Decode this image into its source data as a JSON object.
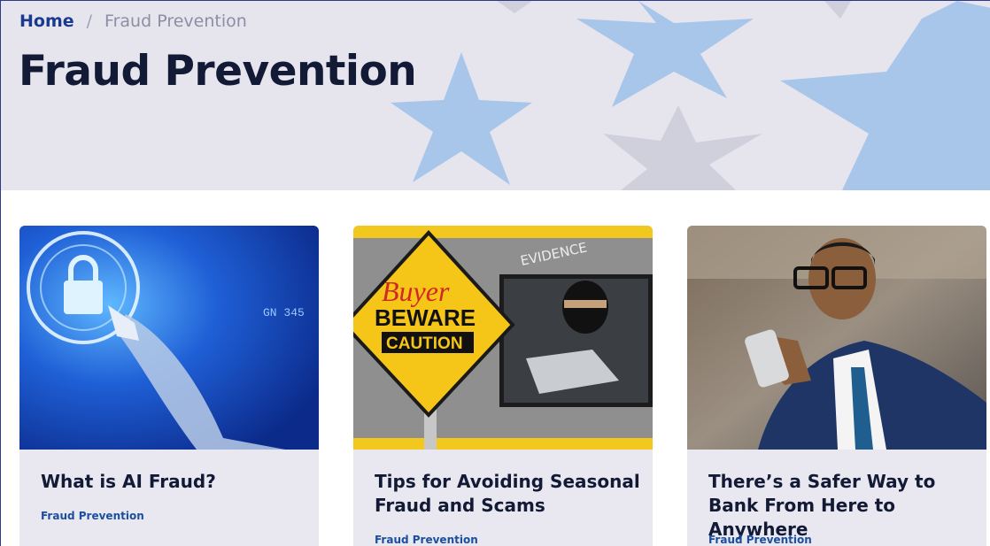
{
  "breadcrumb": {
    "home": "Home",
    "separator": "/",
    "current": "Fraud Prevention"
  },
  "page": {
    "title": "Fraud Prevention"
  },
  "cards": [
    {
      "title": "What is AI Fraud?",
      "category": "Fraud Prevention",
      "image_text": [
        "GN 345"
      ]
    },
    {
      "title": "Tips for Avoiding Seasonal Fraud and Scams",
      "category": "Fraud Prevention",
      "image_text": [
        "Buyer",
        "BEWARE",
        "CAUTION",
        "EVIDENCE"
      ]
    },
    {
      "title": "There’s a Safer Way to Bank From Here to Anywhere",
      "category": "Fraud Prevention",
      "image_text": []
    }
  ],
  "colors": {
    "brand_navy": "#131a36",
    "link_blue": "#1a3a8f",
    "category_blue": "#1a4fa0",
    "hero_bg": "#e6e5ee",
    "card_bg": "#e9e8f1",
    "star_blue": "#a8c6ea"
  }
}
